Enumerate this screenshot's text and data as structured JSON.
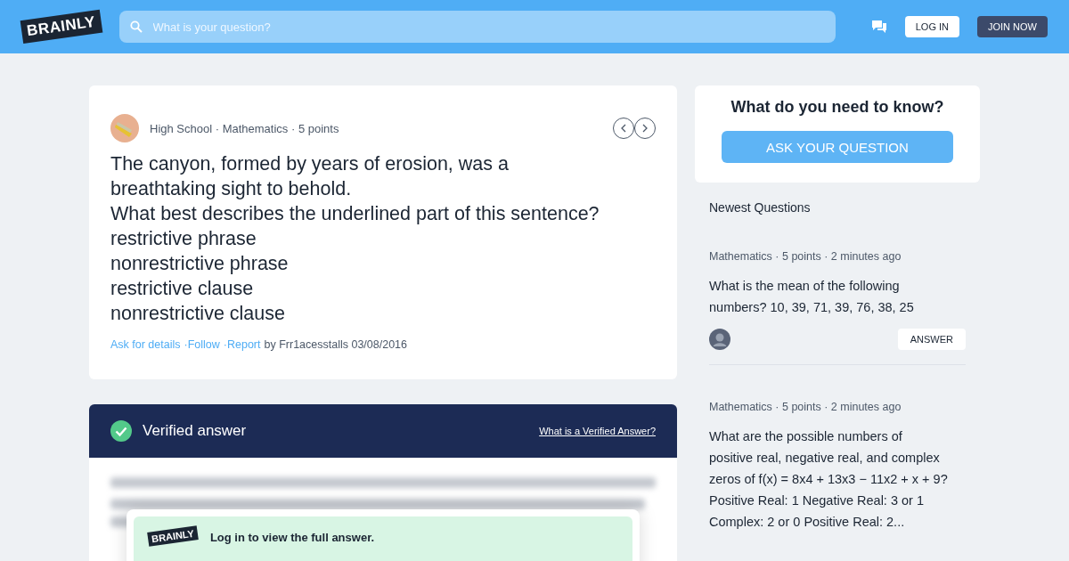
{
  "header": {
    "logo": "BRAINLY",
    "search": {
      "placeholder": "What is your question?"
    },
    "login": "LOG IN",
    "join": "JOIN NOW"
  },
  "question": {
    "meta": "High School · Mathematics · 5 points",
    "lines": [
      "The canyon, formed by years of erosion, was a",
      "breathtaking sight to behold.",
      "What best describes the underlined part of this sentence?",
      "restrictive phrase",
      "nonrestrictive phrase",
      "restrictive clause",
      "nonrestrictive clause"
    ],
    "actions": [
      "Ask for details",
      "·Follow",
      "·Report"
    ],
    "by": "by Frr1acesstalls 03/08/2016"
  },
  "verified": {
    "title": "Verified answer",
    "link": "What is a Verified Answer?",
    "logo": "BRAINLY",
    "prompt": "Log in to view the full answer."
  },
  "ask": {
    "title": "What do you need to know?",
    "button": "ASK YOUR QUESTION"
  },
  "newest": {
    "title": "Newest Questions",
    "items": [
      {
        "meta": "Mathematics · 5 points · 2 minutes ago",
        "lines": [
          "What is the mean of the following",
          "numbers? 10, 39, 71, 39, 76, 38, 25"
        ],
        "answer": "ANSWER"
      },
      {
        "meta": "Mathematics · 5 points · 2 minutes ago",
        "lines": [
          "What are the possible numbers of",
          "positive real, negative real, and complex",
          "zeros of f(x) = 8x4 + 13x3 − 11x2 + x + 9?",
          "Positive Real: 1  Negative Real: 3 or 1",
          "Complex: 2 or 0  Positive Real: 2..."
        ]
      }
    ]
  }
}
